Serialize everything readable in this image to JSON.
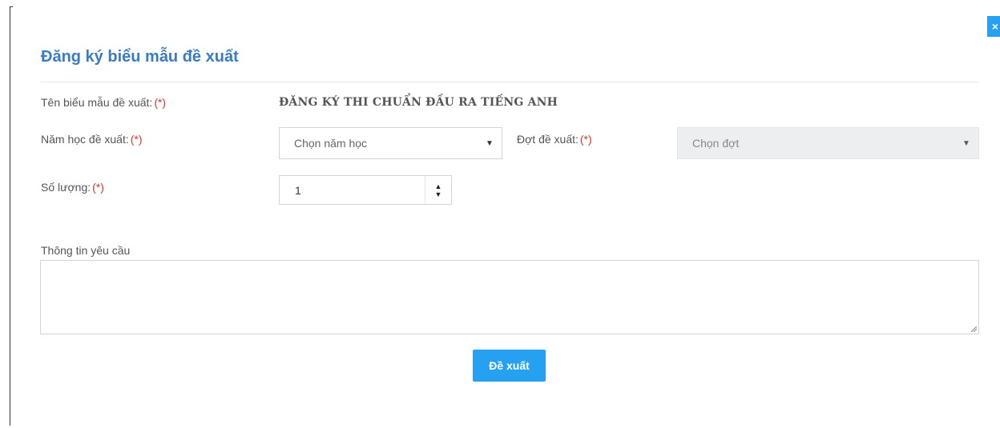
{
  "modal": {
    "title": "Đăng ký biểu mẫu đề xuất",
    "close_label": "×",
    "required_mark": "(*)",
    "form_name": {
      "label": "Tên biểu mẫu đề xuất:",
      "value": "ĐĂNG KÝ THI CHUẨN ĐẦU RA TIẾNG ANH"
    },
    "school_year": {
      "label": "Năm học đề xuất:",
      "placeholder": "Chọn năm học",
      "arrow": "▼"
    },
    "period": {
      "label": "Đợt đề xuất:",
      "placeholder": "Chọn đợt",
      "arrow": "▼"
    },
    "quantity": {
      "label": "Số lượng:",
      "value": "1",
      "up": "▲",
      "down": "▼"
    },
    "request_info": {
      "label": "Thông tin yêu cầu",
      "value": ""
    },
    "submit_label": "Đề xuất"
  },
  "colors": {
    "accent": "#26a0f0",
    "title": "#3a7cc0",
    "required": "#e03030"
  }
}
